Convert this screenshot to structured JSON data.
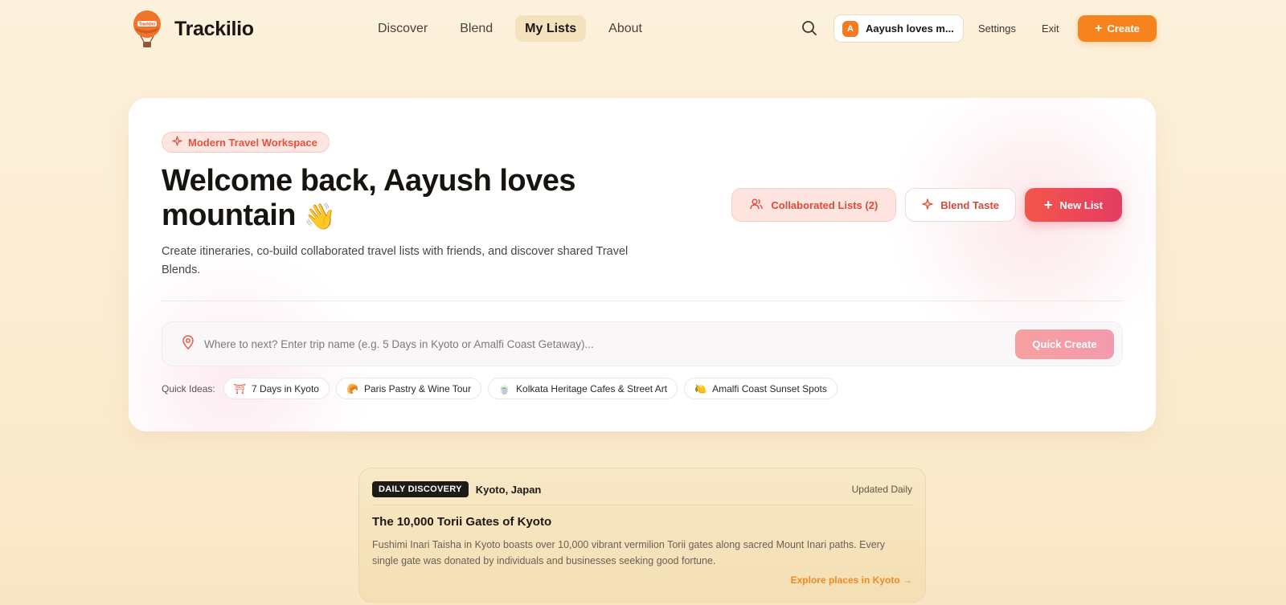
{
  "brand": {
    "name": "Trackilio",
    "logo_text": "Trackilio"
  },
  "nav": {
    "links": [
      {
        "label": "Discover"
      },
      {
        "label": "Blend"
      },
      {
        "label": "My Lists",
        "active": true
      },
      {
        "label": "About"
      }
    ],
    "user": {
      "initial": "A",
      "name": "Aayush loves m..."
    },
    "settings": "Settings",
    "exit": "Exit",
    "create": "Create"
  },
  "hero": {
    "badge": "Modern Travel Workspace",
    "welcome": "Welcome back, Aayush loves mountain",
    "wave_emoji": "👋",
    "subtitle": "Create itineraries, co-build collaborated travel lists with friends, and discover shared Travel Blends.",
    "actions": {
      "collab": "Collaborated Lists (2)",
      "blend": "Blend Taste",
      "new_list": "New List"
    },
    "search": {
      "placeholder": "Where to next? Enter trip name (e.g. 5 Days in Kyoto or Amalfi Coast Getaway)...",
      "value": "",
      "button": "Quick Create"
    },
    "ideas": {
      "label": "Quick Ideas:",
      "items": [
        {
          "icon": "⛩",
          "label": "7 Days in Kyoto"
        },
        {
          "icon": "🥐",
          "label": "Paris Pastry & Wine Tour"
        },
        {
          "icon": "🍵",
          "label": "Kolkata Heritage Cafes & Street Art"
        },
        {
          "icon": "🍋",
          "label": "Amalfi Coast Sunset Spots"
        }
      ]
    }
  },
  "daily": {
    "badge": "DAILY DISCOVERY",
    "location": "Kyoto, Japan",
    "updated": "Updated Daily",
    "title": "The 10,000 Torii Gates of Kyoto",
    "description": "Fushimi Inari Taisha in Kyoto boasts over 10,000 vibrant vermilion Torii gates along sacred Mount Inari paths. Every single gate was donated by individuals and businesses seeking good fortune.",
    "link": "Explore places in Kyoto →"
  },
  "colors": {
    "accent_orange": "#f7831e",
    "accent_red": "#e43c63",
    "background": "#fcf1dc"
  }
}
